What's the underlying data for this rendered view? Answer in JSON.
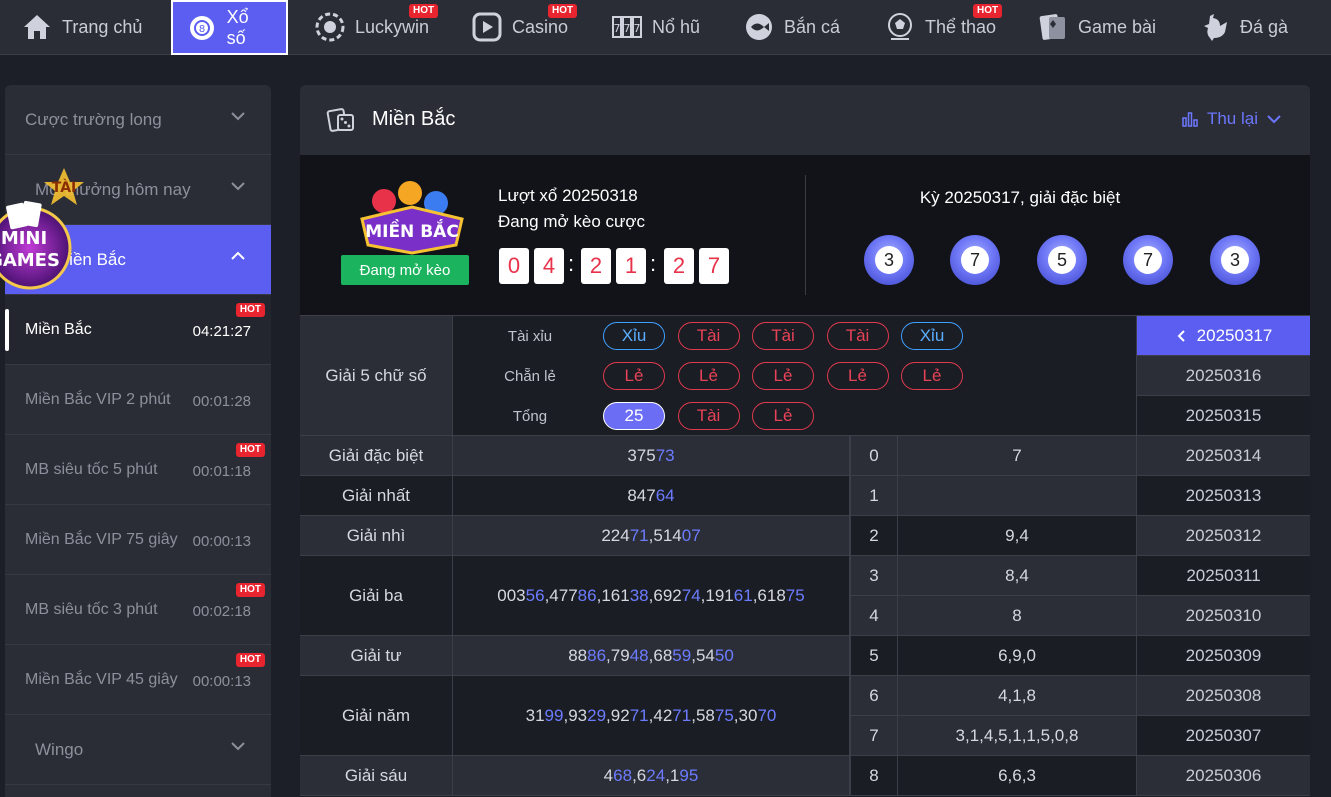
{
  "nav": {
    "items": [
      {
        "label": "Trang chủ",
        "icon": "home-icon"
      },
      {
        "label": "Xổ số",
        "icon": "lottery-ball-icon",
        "active": true
      },
      {
        "label": "Luckywin",
        "icon": "poker-chip-icon",
        "badge": "HOT"
      },
      {
        "label": "Casino",
        "icon": "play-icon",
        "badge": "HOT"
      },
      {
        "label": "Nổ hũ",
        "icon": "slot-777-icon"
      },
      {
        "label": "Bắn cá",
        "icon": "fish-icon"
      },
      {
        "label": "Thể thao",
        "icon": "soccer-ball-icon",
        "badge": "HOT"
      },
      {
        "label": "Game bài",
        "icon": "playing-cards-icon"
      },
      {
        "label": "Đá gà",
        "icon": "rooster-icon"
      }
    ]
  },
  "sidebar": {
    "groups": [
      {
        "label": "Cược trường long"
      },
      {
        "label": "Mở thưởng hôm nay"
      },
      {
        "label": "Miền Bắc"
      }
    ],
    "sub": [
      {
        "label": "Miền Bắc",
        "time": "04:21:27",
        "badge": "HOT"
      },
      {
        "label": "Miền Bắc VIP 2 phút",
        "time": "00:01:28",
        "badge": ""
      },
      {
        "label": "MB siêu tốc 5 phút",
        "time": "00:01:18",
        "badge": "HOT"
      },
      {
        "label": "Miền Bắc VIP 75 giây",
        "time": "00:00:13",
        "badge": ""
      },
      {
        "label": "MB siêu tốc 3 phút",
        "time": "00:02:18",
        "badge": "HOT"
      },
      {
        "label": "Miền Bắc VIP 45 giây",
        "time": "00:00:13",
        "badge": "HOT"
      }
    ],
    "last_group": "Wingo",
    "mini_games": {
      "top": "TÀI",
      "line1": "MINI",
      "line2": "GAMES"
    }
  },
  "panel": {
    "title": "Miền Bắc",
    "replay_label": "Thu lại",
    "logo_text": "MIỀN BẮC",
    "status_button": "Đang mở kèo",
    "draw_line1": "Lượt xổ 20250318",
    "draw_line2": "Đang mở kèo cược",
    "countdown": [
      "0",
      "4",
      "2",
      "1",
      "2",
      "7"
    ],
    "result_title": "Kỳ 20250317, giải đặc biệt",
    "balls": [
      "3",
      "7",
      "5",
      "7",
      "3"
    ]
  },
  "five_digit": {
    "label": "Giải 5 chữ số",
    "rows": [
      {
        "label": "Tài xỉu",
        "pills": [
          {
            "t": "Xỉu",
            "c": "blue"
          },
          {
            "t": "Tài",
            "c": "red"
          },
          {
            "t": "Tài",
            "c": "red"
          },
          {
            "t": "Tài",
            "c": "red"
          },
          {
            "t": "Xỉu",
            "c": "blue"
          }
        ]
      },
      {
        "label": "Chẵn lẻ",
        "pills": [
          {
            "t": "Lẻ",
            "c": "red"
          },
          {
            "t": "Lẻ",
            "c": "red"
          },
          {
            "t": "Lẻ",
            "c": "red"
          },
          {
            "t": "Lẻ",
            "c": "red"
          },
          {
            "t": "Lẻ",
            "c": "red"
          }
        ]
      },
      {
        "label": "Tổng",
        "pills": [
          {
            "t": "25",
            "c": "filled"
          },
          {
            "t": "Tài",
            "c": "red"
          },
          {
            "t": "Lẻ",
            "c": "red"
          }
        ]
      }
    ]
  },
  "prizes": [
    {
      "label": "Giải đặc biệt",
      "parts": [
        [
          "375",
          "73"
        ]
      ]
    },
    {
      "label": "Giải nhất",
      "parts": [
        [
          "847",
          "64"
        ]
      ]
    },
    {
      "label": "Giải nhì",
      "parts": [
        [
          "224",
          "71"
        ],
        [
          "514",
          "07"
        ]
      ]
    },
    {
      "label": "Giải ba",
      "parts": [
        [
          "003",
          "56"
        ],
        [
          "477",
          "86"
        ],
        [
          "161",
          "38"
        ],
        [
          "692",
          "74"
        ],
        [
          "191",
          "61"
        ],
        [
          "618",
          "75"
        ]
      ]
    },
    {
      "label": "Giải tư",
      "parts": [
        [
          "88",
          "86"
        ],
        [
          "79",
          "48"
        ],
        [
          "68",
          "59"
        ],
        [
          "54",
          "50"
        ]
      ]
    },
    {
      "label": "Giải năm",
      "parts": [
        [
          "31",
          "99"
        ],
        [
          "93",
          "29"
        ],
        [
          "92",
          "71"
        ],
        [
          "42",
          "71"
        ],
        [
          "58",
          "75"
        ],
        [
          "30",
          "70"
        ]
      ]
    },
    {
      "label": "Giải sáu",
      "parts": [
        [
          "4",
          "68"
        ],
        [
          "6",
          "24"
        ],
        [
          "1",
          "95"
        ]
      ]
    }
  ],
  "heads": [
    {
      "d": "0",
      "v": "7"
    },
    {
      "d": "1",
      "v": ""
    },
    {
      "d": "2",
      "v": "9,4"
    },
    {
      "d": "3",
      "v": "8,4"
    },
    {
      "d": "4",
      "v": "8"
    },
    {
      "d": "5",
      "v": "6,9,0"
    },
    {
      "d": "6",
      "v": "4,1,8"
    },
    {
      "d": "7",
      "v": "3,1,4,5,1,1,5,0,8"
    },
    {
      "d": "8",
      "v": "6,6,3"
    }
  ],
  "dates": [
    "20250317",
    "20250316",
    "20250315",
    "20250314",
    "20250313",
    "20250312",
    "20250311",
    "20250310",
    "20250309",
    "20250308",
    "20250307",
    "20250306"
  ]
}
